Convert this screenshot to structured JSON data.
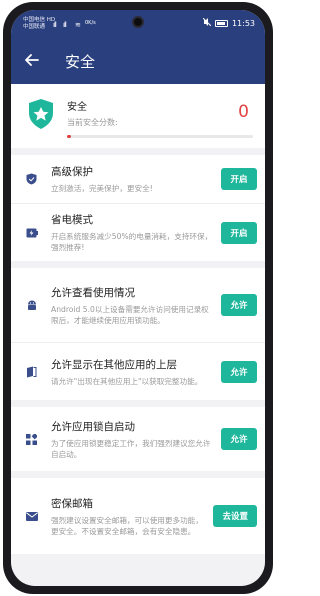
{
  "statusbar": {
    "carrier_line1": "中国电信 HD",
    "carrier_line2": "中国联通",
    "signal1": "ıll",
    "signal2": "ıll",
    "wifi": "≋",
    "speed": "0K/s",
    "time": "11:53"
  },
  "header": {
    "back_icon": "arrow-left-icon",
    "title": "安全"
  },
  "score": {
    "label": "安全",
    "sublabel": "当前安全分数:",
    "value": "0",
    "progress_fraction": 0.02,
    "accent": "#e04343",
    "shield_color": "#1fb79b"
  },
  "groups": [
    {
      "rows": [
        {
          "icon": "shield-icon",
          "title": "高级保护",
          "desc": "立刻激活，完美保护，更安全!",
          "button": "开启"
        },
        {
          "icon": "battery-saver-icon",
          "title": "省电模式",
          "desc": "开启系统服务减少50%的电量消耗，支持环保，强烈推荐!",
          "button": "开启"
        }
      ]
    },
    {
      "rows": [
        {
          "icon": "android-icon",
          "title": "允许查看使用情况",
          "desc": "Android 5.0以上设备需要允许访问使用记录权限后，才能继续使用应用锁功能。",
          "button": "允许"
        },
        {
          "icon": "overlay-icon",
          "title": "允许显示在其他应用的上层",
          "desc": "请允许\"出现在其他应用上\"以获取完整功能。",
          "button": "允许"
        }
      ]
    },
    {
      "rows": [
        {
          "icon": "apps-grid-icon",
          "title": "允许应用锁自启动",
          "desc": "为了使应用锁更稳定工作，我们强烈建议您允许自启动。",
          "button": "允许"
        }
      ]
    },
    {
      "rows": [
        {
          "icon": "mail-icon",
          "title": "密保邮箱",
          "desc": "强烈建议设置安全邮箱，可以使用更多功能，更安全。不设置安全邮箱，会有安全隐患。",
          "button": "去设置"
        }
      ]
    }
  ],
  "colors": {
    "header": "#2a3f7e",
    "button": "#1fb79b",
    "icon": "#3b4e8c"
  }
}
